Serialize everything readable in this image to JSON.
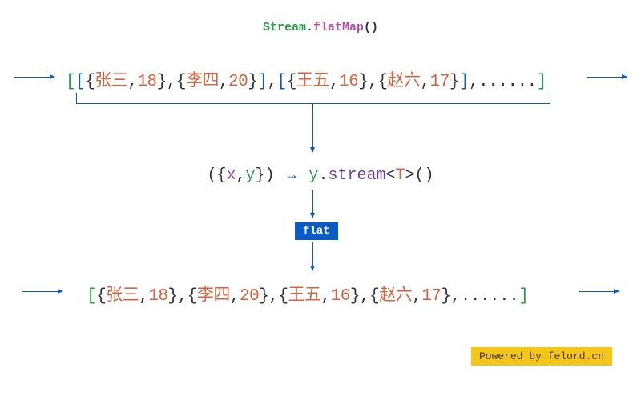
{
  "title": {
    "class": "Stream",
    "method": "flatMap"
  },
  "input": {
    "groups": [
      {
        "items": [
          {
            "name": "张三",
            "age": 18
          },
          {
            "name": "李四",
            "age": 20
          }
        ]
      },
      {
        "items": [
          {
            "name": "王五",
            "age": 16
          },
          {
            "name": "赵六",
            "age": 17
          }
        ]
      }
    ],
    "trailing": "......"
  },
  "lambda": {
    "params": "x,y",
    "arrow": "→",
    "target": "y",
    "method": "stream",
    "type": "T"
  },
  "flat_label": "flat",
  "output": {
    "items": [
      {
        "name": "张三",
        "age": 18
      },
      {
        "name": "李四",
        "age": 20
      },
      {
        "name": "王五",
        "age": 16
      },
      {
        "name": "赵六",
        "age": 17
      }
    ],
    "trailing": "......"
  },
  "credit": "Powered by felord.cn"
}
